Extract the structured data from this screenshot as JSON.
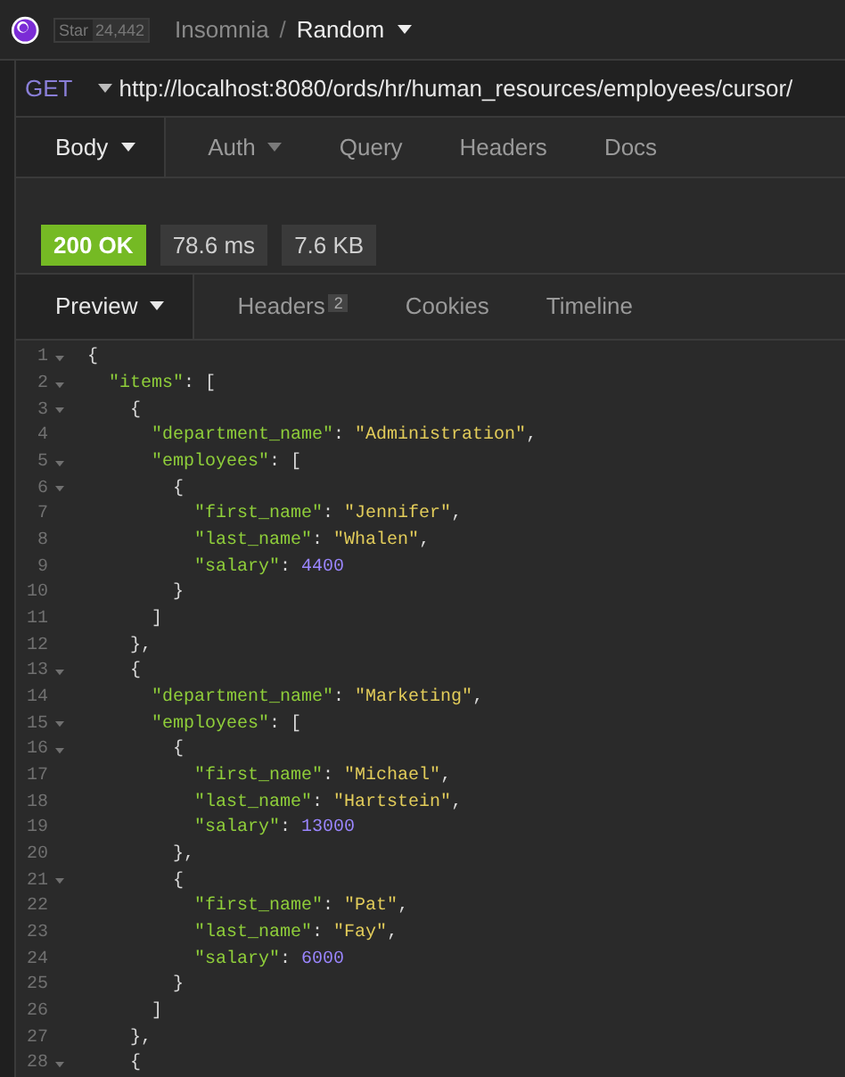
{
  "topbar": {
    "star_label": "Star",
    "star_count": "24,442",
    "workspace": "Insomnia",
    "separator": "/",
    "request_name": "Random"
  },
  "request": {
    "method": "GET",
    "url": "http://localhost:8080/ords/hr/human_resources/employees/cursor/"
  },
  "request_tabs": [
    {
      "label": "Body",
      "selected": true,
      "dropdown": true
    },
    {
      "label": "Auth",
      "selected": false,
      "dropdown": true
    },
    {
      "label": "Query",
      "selected": false,
      "dropdown": false
    },
    {
      "label": "Headers",
      "selected": false,
      "dropdown": false
    },
    {
      "label": "Docs",
      "selected": false,
      "dropdown": false
    }
  ],
  "response": {
    "status": "200 OK",
    "time": "78.6 ms",
    "size": "7.6 KB"
  },
  "response_tabs": [
    {
      "label": "Preview",
      "selected": true,
      "dropdown": true
    },
    {
      "label": "Headers",
      "selected": false,
      "dropdown": false,
      "badge": "2"
    },
    {
      "label": "Cookies",
      "selected": false,
      "dropdown": false
    },
    {
      "label": "Timeline",
      "selected": false,
      "dropdown": false
    }
  ],
  "code_lines": [
    {
      "number": "1",
      "foldable": true,
      "tokens": [
        {
          "kind": "punct",
          "text": "{"
        }
      ]
    },
    {
      "number": "2",
      "foldable": true,
      "tokens": [
        {
          "kind": "key",
          "text": "  \"items\""
        },
        {
          "kind": "punct",
          "text": ": ["
        }
      ]
    },
    {
      "number": "3",
      "foldable": true,
      "tokens": [
        {
          "kind": "punct",
          "text": "    {"
        }
      ]
    },
    {
      "number": "4",
      "foldable": false,
      "tokens": [
        {
          "kind": "key",
          "text": "      \"department_name\""
        },
        {
          "kind": "punct",
          "text": ": "
        },
        {
          "kind": "string",
          "text": "\"Administration\""
        },
        {
          "kind": "punct",
          "text": ","
        }
      ]
    },
    {
      "number": "5",
      "foldable": true,
      "tokens": [
        {
          "kind": "key",
          "text": "      \"employees\""
        },
        {
          "kind": "punct",
          "text": ": ["
        }
      ]
    },
    {
      "number": "6",
      "foldable": true,
      "tokens": [
        {
          "kind": "punct",
          "text": "        {"
        }
      ]
    },
    {
      "number": "7",
      "foldable": false,
      "tokens": [
        {
          "kind": "key",
          "text": "          \"first_name\""
        },
        {
          "kind": "punct",
          "text": ": "
        },
        {
          "kind": "string",
          "text": "\"Jennifer\""
        },
        {
          "kind": "punct",
          "text": ","
        }
      ]
    },
    {
      "number": "8",
      "foldable": false,
      "tokens": [
        {
          "kind": "key",
          "text": "          \"last_name\""
        },
        {
          "kind": "punct",
          "text": ": "
        },
        {
          "kind": "string",
          "text": "\"Whalen\""
        },
        {
          "kind": "punct",
          "text": ","
        }
      ]
    },
    {
      "number": "9",
      "foldable": false,
      "tokens": [
        {
          "kind": "key",
          "text": "          \"salary\""
        },
        {
          "kind": "punct",
          "text": ": "
        },
        {
          "kind": "number",
          "text": "4400"
        }
      ]
    },
    {
      "number": "10",
      "foldable": false,
      "tokens": [
        {
          "kind": "punct",
          "text": "        }"
        }
      ]
    },
    {
      "number": "11",
      "foldable": false,
      "tokens": [
        {
          "kind": "punct",
          "text": "      ]"
        }
      ]
    },
    {
      "number": "12",
      "foldable": false,
      "tokens": [
        {
          "kind": "punct",
          "text": "    },"
        }
      ]
    },
    {
      "number": "13",
      "foldable": true,
      "tokens": [
        {
          "kind": "punct",
          "text": "    {"
        }
      ]
    },
    {
      "number": "14",
      "foldable": false,
      "tokens": [
        {
          "kind": "key",
          "text": "      \"department_name\""
        },
        {
          "kind": "punct",
          "text": ": "
        },
        {
          "kind": "string",
          "text": "\"Marketing\""
        },
        {
          "kind": "punct",
          "text": ","
        }
      ]
    },
    {
      "number": "15",
      "foldable": true,
      "tokens": [
        {
          "kind": "key",
          "text": "      \"employees\""
        },
        {
          "kind": "punct",
          "text": ": ["
        }
      ]
    },
    {
      "number": "16",
      "foldable": true,
      "tokens": [
        {
          "kind": "punct",
          "text": "        {"
        }
      ]
    },
    {
      "number": "17",
      "foldable": false,
      "tokens": [
        {
          "kind": "key",
          "text": "          \"first_name\""
        },
        {
          "kind": "punct",
          "text": ": "
        },
        {
          "kind": "string",
          "text": "\"Michael\""
        },
        {
          "kind": "punct",
          "text": ","
        }
      ]
    },
    {
      "number": "18",
      "foldable": false,
      "tokens": [
        {
          "kind": "key",
          "text": "          \"last_name\""
        },
        {
          "kind": "punct",
          "text": ": "
        },
        {
          "kind": "string",
          "text": "\"Hartstein\""
        },
        {
          "kind": "punct",
          "text": ","
        }
      ]
    },
    {
      "number": "19",
      "foldable": false,
      "tokens": [
        {
          "kind": "key",
          "text": "          \"salary\""
        },
        {
          "kind": "punct",
          "text": ": "
        },
        {
          "kind": "number",
          "text": "13000"
        }
      ]
    },
    {
      "number": "20",
      "foldable": false,
      "tokens": [
        {
          "kind": "punct",
          "text": "        },"
        }
      ]
    },
    {
      "number": "21",
      "foldable": true,
      "tokens": [
        {
          "kind": "punct",
          "text": "        {"
        }
      ]
    },
    {
      "number": "22",
      "foldable": false,
      "tokens": [
        {
          "kind": "key",
          "text": "          \"first_name\""
        },
        {
          "kind": "punct",
          "text": ": "
        },
        {
          "kind": "string",
          "text": "\"Pat\""
        },
        {
          "kind": "punct",
          "text": ","
        }
      ]
    },
    {
      "number": "23",
      "foldable": false,
      "tokens": [
        {
          "kind": "key",
          "text": "          \"last_name\""
        },
        {
          "kind": "punct",
          "text": ": "
        },
        {
          "kind": "string",
          "text": "\"Fay\""
        },
        {
          "kind": "punct",
          "text": ","
        }
      ]
    },
    {
      "number": "24",
      "foldable": false,
      "tokens": [
        {
          "kind": "key",
          "text": "          \"salary\""
        },
        {
          "kind": "punct",
          "text": ": "
        },
        {
          "kind": "number",
          "text": "6000"
        }
      ]
    },
    {
      "number": "25",
      "foldable": false,
      "tokens": [
        {
          "kind": "punct",
          "text": "        }"
        }
      ]
    },
    {
      "number": "26",
      "foldable": false,
      "tokens": [
        {
          "kind": "punct",
          "text": "      ]"
        }
      ]
    },
    {
      "number": "27",
      "foldable": false,
      "tokens": [
        {
          "kind": "punct",
          "text": "    },"
        }
      ]
    },
    {
      "number": "28",
      "foldable": true,
      "tokens": [
        {
          "kind": "punct",
          "text": "    {"
        }
      ]
    }
  ]
}
